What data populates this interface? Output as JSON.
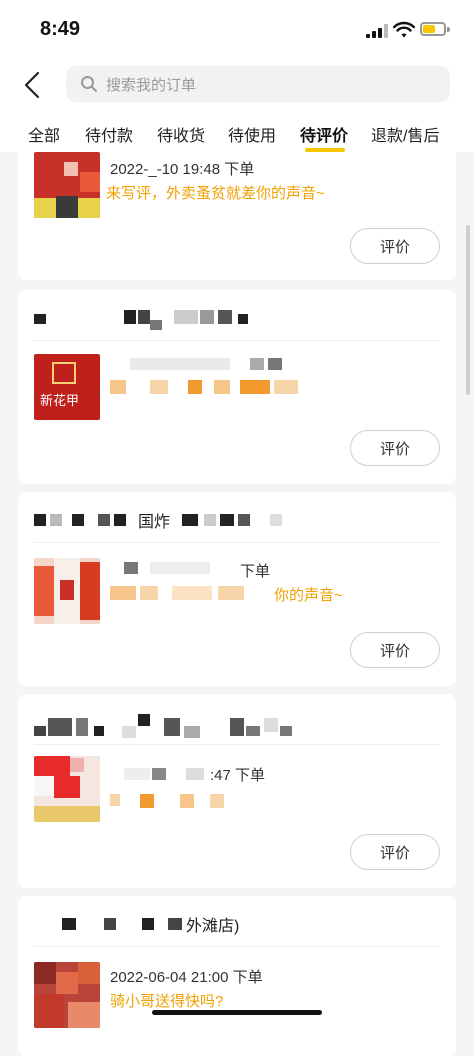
{
  "status": {
    "time": "8:49"
  },
  "search": {
    "placeholder": "搜索我的订单"
  },
  "tabs": [
    {
      "label": "全部"
    },
    {
      "label": "待付款"
    },
    {
      "label": "待收货"
    },
    {
      "label": "待使用"
    },
    {
      "label": "待评价",
      "active": true
    },
    {
      "label": "退款/售后"
    }
  ],
  "orders": [
    {
      "shop": "",
      "meta": "2022-_-10 19:48 下单",
      "prompt": "来写评，外卖蚤贫就差你的声音~",
      "action": "评价"
    },
    {
      "shop": "",
      "meta": "",
      "prompt": "",
      "thumb_text": "新花甲",
      "action": "评价"
    },
    {
      "shop": "国炸",
      "meta": "下单",
      "prompt": "你的声音~",
      "action": "评价"
    },
    {
      "shop": "",
      "meta": ":47 下单",
      "prompt": "",
      "action": "评价"
    },
    {
      "shop": "外滩店)",
      "meta": "2022-06-04 21:00 下单",
      "prompt": "骑小哥送得快吗?",
      "action": "评价"
    }
  ]
}
